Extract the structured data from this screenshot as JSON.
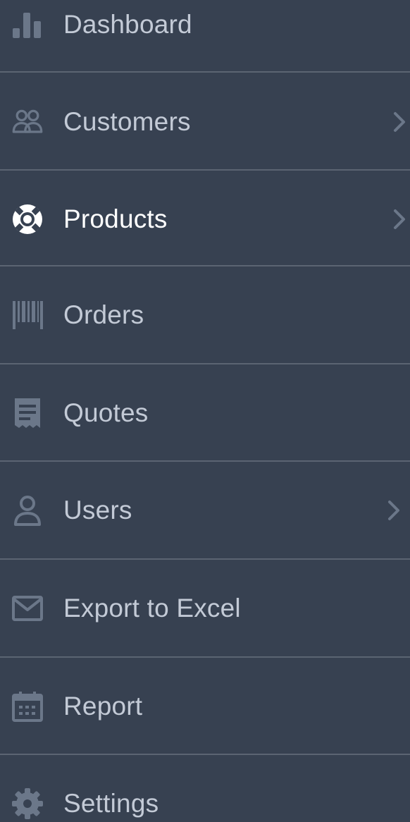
{
  "colors": {
    "background": "#374151",
    "divider": "#5b6472",
    "icon": "#6b7789",
    "label": "#c3cad6",
    "active": "#ffffff"
  },
  "menu": {
    "items": [
      {
        "label": "Dashboard",
        "icon": "bar-chart-icon",
        "has_submenu": false,
        "active": false
      },
      {
        "label": "Customers",
        "icon": "users-group-icon",
        "has_submenu": true,
        "active": false
      },
      {
        "label": "Products",
        "icon": "lifebuoy-icon",
        "has_submenu": true,
        "active": true
      },
      {
        "label": "Orders",
        "icon": "barcode-icon",
        "has_submenu": false,
        "active": false
      },
      {
        "label": "Quotes",
        "icon": "receipt-icon",
        "has_submenu": false,
        "active": false
      },
      {
        "label": "Users",
        "icon": "user-icon",
        "has_submenu": true,
        "active": false
      },
      {
        "label": "Export to Excel",
        "icon": "envelope-icon",
        "has_submenu": false,
        "active": false
      },
      {
        "label": "Report",
        "icon": "calendar-icon",
        "has_submenu": false,
        "active": false
      },
      {
        "label": "Settings",
        "icon": "gear-icon",
        "has_submenu": false,
        "active": false
      }
    ]
  }
}
